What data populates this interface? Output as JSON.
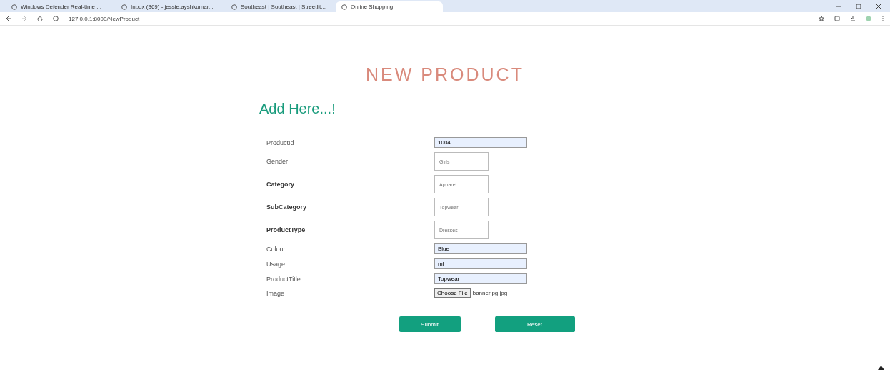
{
  "browser": {
    "tabs": [
      {
        "title": "Windows Defender Real-time ...",
        "selected": false
      },
      {
        "title": "Inbox (369) - jessie.ayshkumar...",
        "selected": false
      },
      {
        "title": "Southeast | Southeast | Streetlit...",
        "selected": false
      },
      {
        "title": "Online Shopping",
        "selected": true
      }
    ],
    "url": "127.0.0.1:8000/NewProduct"
  },
  "page": {
    "title": "NEW PRODUCT",
    "subtitle": "Add Here...!",
    "fields": [
      {
        "label": "ProductId",
        "bold": false,
        "kind": "text",
        "value": "1004"
      },
      {
        "label": "Gender",
        "bold": false,
        "kind": "box",
        "placeholder": "Girls"
      },
      {
        "label": "Category",
        "bold": true,
        "kind": "box",
        "placeholder": "Apparel"
      },
      {
        "label": "SubCategory",
        "bold": true,
        "kind": "box",
        "placeholder": "Topwear"
      },
      {
        "label": "ProductType",
        "bold": true,
        "kind": "box",
        "placeholder": "Dresses"
      },
      {
        "label": "Colour",
        "bold": false,
        "kind": "text",
        "value": "Blue"
      },
      {
        "label": "Usage",
        "bold": false,
        "kind": "text",
        "value": "ml"
      },
      {
        "label": "ProductTitle",
        "bold": false,
        "kind": "text",
        "value": "Topwear"
      },
      {
        "label": "Image",
        "bold": false,
        "kind": "file",
        "button": "Choose File",
        "file": "bannerjpg.jpg"
      }
    ],
    "buttons": [
      "Submit",
      "Reset"
    ]
  }
}
